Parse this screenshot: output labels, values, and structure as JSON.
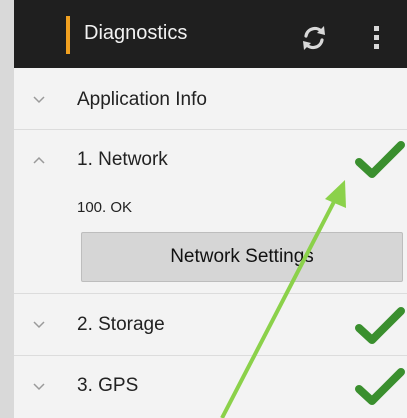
{
  "action_bar": {
    "title": "Diagnostics",
    "refresh_icon": "refresh-icon",
    "overflow_icon": "overflow-menu-icon"
  },
  "list": {
    "items": [
      {
        "label": "Application Info",
        "expanded": false,
        "status": null
      },
      {
        "label": "1. Network",
        "expanded": true,
        "status": "ok",
        "detail": "100. OK",
        "button_label": "Network Settings"
      },
      {
        "label": "2. Storage",
        "expanded": false,
        "status": "ok"
      },
      {
        "label": "3. GPS",
        "expanded": false,
        "status": "ok"
      }
    ]
  },
  "colors": {
    "action_bar": "#1f1f1f",
    "accent": "#f0a020",
    "check": "#3a8f2e",
    "annotation_arrow": "#8bd14a"
  }
}
